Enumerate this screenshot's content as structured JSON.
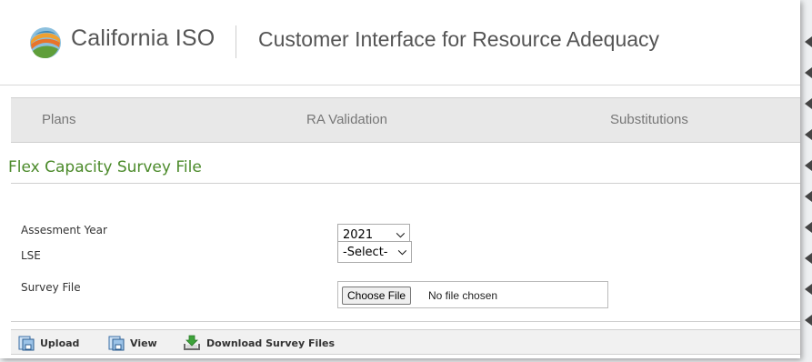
{
  "header": {
    "brand": "California ISO",
    "app_title": "Customer Interface for Resource Adequacy"
  },
  "nav": {
    "items": [
      {
        "label": "Plans"
      },
      {
        "label": "RA Validation"
      },
      {
        "label": "Substitutions"
      }
    ]
  },
  "section": {
    "title": "Flex Capacity Survey File"
  },
  "form": {
    "assessment_year": {
      "label": "Assesment Year",
      "selected": "2021"
    },
    "lse": {
      "label": "LSE",
      "selected": "-Select-"
    },
    "survey_file": {
      "label": "Survey File",
      "button": "Choose File",
      "status": "No file chosen"
    }
  },
  "toolbar": {
    "upload": "Upload",
    "view": "View",
    "download": "Download Survey Files"
  },
  "colors": {
    "accent_green": "#4b8a2a",
    "nav_bg": "#e8e8e8",
    "text_gray": "#555555"
  },
  "icons": [
    "california-iso-logo",
    "upload-icon",
    "view-icon",
    "download-icon",
    "chevron-down-icon"
  ]
}
